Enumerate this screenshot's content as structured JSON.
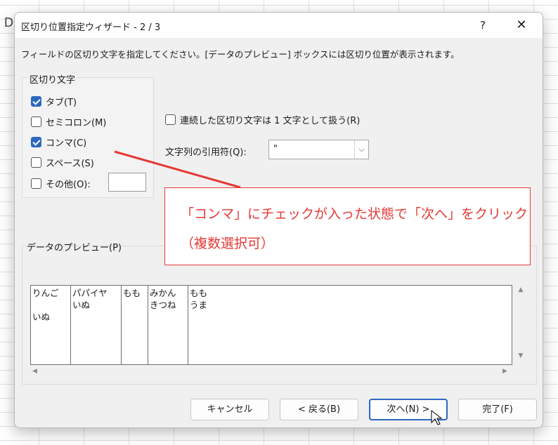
{
  "background": {
    "column_letter": "D"
  },
  "dialog": {
    "title": "区切り位置指定ウィザード - 2 / 3",
    "help_glyph": "?",
    "close_glyph": "✕",
    "instruction": "フィールドの区切り文字を指定してください。[データのプレビュー] ボックスには区切り位置が表示されます。"
  },
  "delimiters": {
    "group_label": "区切り文字",
    "items": [
      {
        "label": "タブ(T)",
        "checked": true
      },
      {
        "label": "セミコロン(M)",
        "checked": false
      },
      {
        "label": "コンマ(C)",
        "checked": true
      },
      {
        "label": "スペース(S)",
        "checked": false
      },
      {
        "label": "その他(O):",
        "checked": false
      }
    ],
    "other_value": ""
  },
  "options": {
    "consecutive_label": "連続した区切り文字は 1 文字として扱う(R)",
    "consecutive_checked": false,
    "quote_label": "文字列の引用符(Q):",
    "quote_value": "\""
  },
  "preview": {
    "label": "データのプレビュー(P)",
    "columns": [
      {
        "rows": [
          "りんご",
          "",
          "いぬ"
        ]
      },
      {
        "rows": [
          "パパイヤ",
          "いぬ",
          ""
        ]
      },
      {
        "rows": [
          "もも",
          "",
          ""
        ]
      },
      {
        "rows": [
          "みかん",
          "きつね",
          ""
        ]
      },
      {
        "rows": [
          "もも",
          "うま",
          ""
        ]
      }
    ],
    "scroll": {
      "up": "▲",
      "down": "▼",
      "left": "◀",
      "right": "▶"
    }
  },
  "buttons": {
    "cancel": "キャンセル",
    "back": "< 戻る(B)",
    "next": "次へ(N) >",
    "finish": "完了(F)"
  },
  "annotation": {
    "line1": "「コンマ」にチェックが入った状態で「次へ」をクリック",
    "line2": "（複数選択可）",
    "color": "#e53935"
  }
}
